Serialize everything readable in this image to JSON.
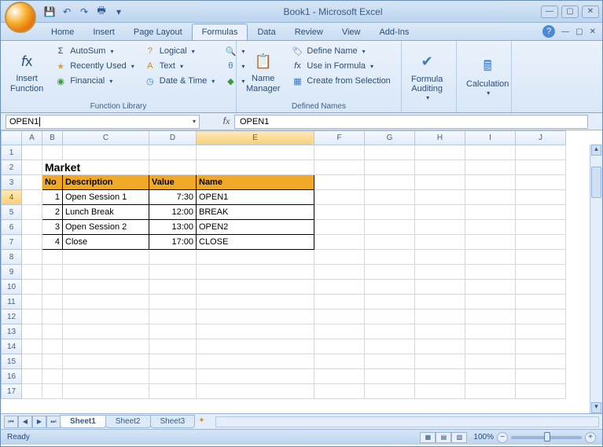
{
  "window": {
    "title": "Book1 - Microsoft Excel"
  },
  "tabs": {
    "home": "Home",
    "insert": "Insert",
    "pagelayout": "Page Layout",
    "formulas": "Formulas",
    "data": "Data",
    "review": "Review",
    "view": "View",
    "addins": "Add-Ins"
  },
  "ribbon": {
    "insert_function": "Insert\nFunction",
    "autosum": "AutoSum",
    "recently": "Recently Used",
    "financial": "Financial",
    "logical": "Logical",
    "text": "Text",
    "datetime": "Date & Time",
    "group_funclib": "Function Library",
    "name_manager": "Name\nManager",
    "define_name": "Define Name",
    "use_in_formula": "Use in Formula",
    "create_from_sel": "Create from Selection",
    "group_defnames": "Defined Names",
    "formula_auditing": "Formula\nAuditing",
    "calculation": "Calculation"
  },
  "namebox": "OPEN1",
  "formula": "OPEN1",
  "columns": [
    "A",
    "B",
    "C",
    "D",
    "E",
    "F",
    "G",
    "H",
    "I",
    "J"
  ],
  "rows": [
    "1",
    "2",
    "3",
    "4",
    "5",
    "6",
    "7",
    "8",
    "9",
    "10",
    "11",
    "12",
    "13",
    "14",
    "15",
    "16",
    "17"
  ],
  "sheet": {
    "title": "Market",
    "headers": {
      "no": "No",
      "desc": "Description",
      "value": "Value",
      "name": "Name"
    },
    "rows": [
      {
        "no": "1",
        "desc": "Open Session 1",
        "value": "7:30",
        "name": "OPEN1"
      },
      {
        "no": "2",
        "desc": "Lunch Break",
        "value": "12:00",
        "name": "BREAK"
      },
      {
        "no": "3",
        "desc": "Open Session 2",
        "value": "13:00",
        "name": "OPEN2"
      },
      {
        "no": "4",
        "desc": "Close",
        "value": "17:00",
        "name": "CLOSE"
      }
    ]
  },
  "tabsheets": {
    "s1": "Sheet1",
    "s2": "Sheet2",
    "s3": "Sheet3"
  },
  "status": {
    "ready": "Ready",
    "zoom": "100%"
  }
}
